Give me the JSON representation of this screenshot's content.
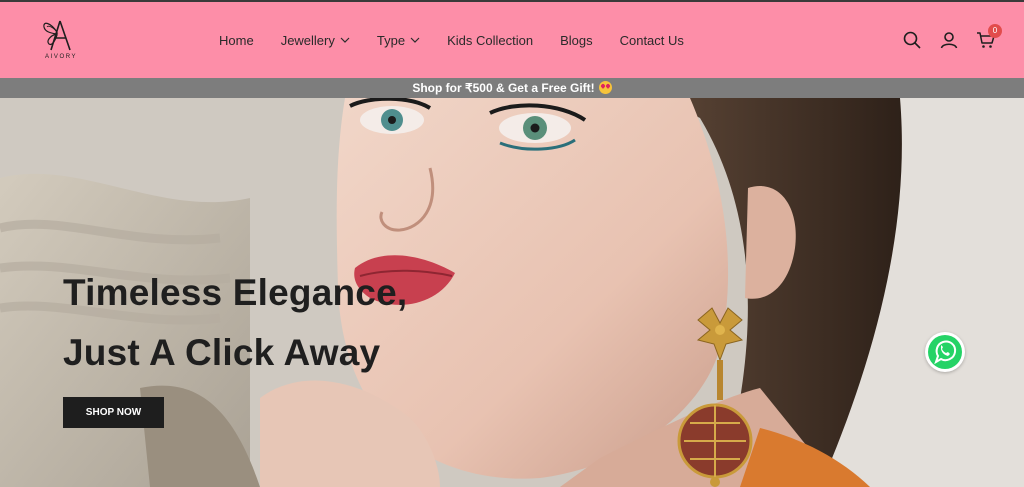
{
  "brand": {
    "name": "AIVORY"
  },
  "nav": {
    "items": [
      {
        "label": "Home",
        "has_dropdown": false
      },
      {
        "label": "Jewellery",
        "has_dropdown": true
      },
      {
        "label": "Type",
        "has_dropdown": true
      },
      {
        "label": "Kids Collection",
        "has_dropdown": false
      },
      {
        "label": "Blogs",
        "has_dropdown": false
      },
      {
        "label": "Contact Us",
        "has_dropdown": false
      }
    ]
  },
  "header_icons": {
    "search": "search-icon",
    "account": "user-icon",
    "cart": "cart-icon",
    "cart_count": "0"
  },
  "promo": {
    "text": "Shop for ₹500 & Get a Free Gift!"
  },
  "hero": {
    "headline_line1": "Timeless Elegance,",
    "headline_line2": "Just A Click Away",
    "cta_label": "SHOP NOW"
  },
  "colors": {
    "header_bg": "#fd8ea8",
    "promo_bg": "#7d7d7d",
    "cta_bg": "#1e1e1e",
    "badge": "#e24c4c",
    "whatsapp": "#25d366"
  }
}
